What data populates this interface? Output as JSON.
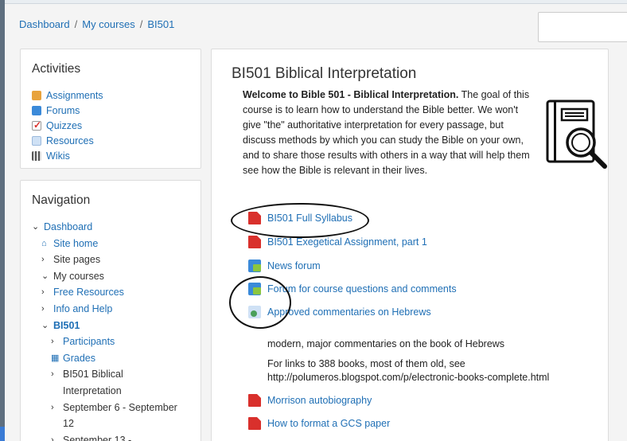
{
  "breadcrumb": {
    "items": [
      "Dashboard",
      "My courses",
      "BI501"
    ],
    "separator": "/"
  },
  "activities": {
    "title": "Activities",
    "items": [
      {
        "label": "Assignments",
        "icon": "assignment-icon",
        "color": "#e8a33d"
      },
      {
        "label": "Forums",
        "icon": "forum-icon",
        "color": "#3b8ad9"
      },
      {
        "label": "Quizzes",
        "icon": "quiz-icon",
        "color": "#d9302c"
      },
      {
        "label": "Resources",
        "icon": "resource-icon",
        "color": "#cfe1f5"
      },
      {
        "label": "Wikis",
        "icon": "wiki-icon",
        "color": "#555555"
      }
    ]
  },
  "navigation": {
    "title": "Navigation",
    "items": [
      {
        "label": "Dashboard",
        "chevron": "⌄",
        "link": true,
        "indent": 0
      },
      {
        "label": "Site home",
        "chevron": "⌂",
        "link": true,
        "indent": 1
      },
      {
        "label": "Site pages",
        "chevron": "›",
        "link": false,
        "indent": 1
      },
      {
        "label": "My courses",
        "chevron": "⌄",
        "link": false,
        "indent": 1
      },
      {
        "label": "Free Resources",
        "chevron": "›",
        "link": true,
        "indent": 2
      },
      {
        "label": "Info and Help",
        "chevron": "›",
        "link": true,
        "indent": 2
      },
      {
        "label": "BI501",
        "chevron": "⌄",
        "link": true,
        "indent": 2,
        "bold": true
      },
      {
        "label": "Participants",
        "chevron": "›",
        "link": true,
        "indent": 3
      },
      {
        "label": "Grades",
        "chevron": "▦",
        "link": true,
        "indent": 3
      },
      {
        "label": "BI501 Biblical",
        "chevron": "›",
        "link": false,
        "indent": 3
      },
      {
        "label": "Interpretation",
        "chevron": "",
        "link": false,
        "indent": 3
      },
      {
        "label": "September 6 - September",
        "chevron": "›",
        "link": false,
        "indent": 3
      },
      {
        "label": "12",
        "chevron": "",
        "link": false,
        "indent": 3
      },
      {
        "label": "September 13 -",
        "chevron": "›",
        "link": false,
        "indent": 3
      }
    ]
  },
  "course": {
    "title": "BI501 Biblical Interpretation",
    "intro_bold": "Welcome to Bible 501 - Biblical Interpretation.",
    "intro_rest": " The goal of this course is to learn how to understand the Bible better. We won't give \"the\" authoritative interpretation for every passage, but discuss methods by which you can study the Bible on your own, and to share those results with others in a way that will help them see how the Bible is relevant in their lives."
  },
  "resources": [
    {
      "label": "BI501 Full Syllabus",
      "type": "pdf"
    },
    {
      "label": "BI501 Exegetical Assignment, part 1",
      "type": "pdf"
    },
    {
      "label": "News forum",
      "type": "forum"
    },
    {
      "label": "Forum for course questions and comments",
      "type": "forum"
    },
    {
      "label": "Approved commentaries on Hebrews",
      "type": "url"
    }
  ],
  "descriptions": {
    "line1": "modern, major commentaries on the book of Hebrews",
    "line2": "For links to 388 books, most of them old, see",
    "line3": "http://polumeros.blogspot.com/p/electronic-books-complete.html"
  },
  "resources2": [
    {
      "label": "Morrison autobiography",
      "type": "pdf"
    },
    {
      "label": "How to format a GCS paper",
      "type": "pdf"
    }
  ]
}
